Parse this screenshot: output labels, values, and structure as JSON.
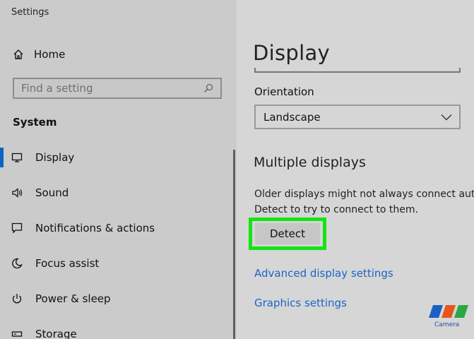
{
  "app": {
    "title": "Settings"
  },
  "sidebar": {
    "home_label": "Home",
    "search_placeholder": "Find a setting",
    "section_title": "System",
    "items": [
      {
        "label": "Display",
        "icon": "monitor-icon",
        "active": true
      },
      {
        "label": "Sound",
        "icon": "speaker-icon"
      },
      {
        "label": "Notifications & actions",
        "icon": "notification-icon"
      },
      {
        "label": "Focus assist",
        "icon": "moon-icon"
      },
      {
        "label": "Power & sleep",
        "icon": "power-icon"
      },
      {
        "label": "Storage",
        "icon": "storage-icon"
      }
    ]
  },
  "main": {
    "title": "Display",
    "orientation_label": "Orientation",
    "orientation_value": "Landscape",
    "multiple_displays_heading": "Multiple displays",
    "description_line1": "Older displays might not always connect auto",
    "description_line2": "Detect to try to connect to them.",
    "detect_label": "Detect",
    "advanced_link": "Advanced display settings",
    "graphics_link": "Graphics settings"
  },
  "watermark": {
    "text": "Camera"
  },
  "colors": {
    "accent": "#0b66c2",
    "link": "#1a66c7",
    "highlight": "#13e413"
  }
}
